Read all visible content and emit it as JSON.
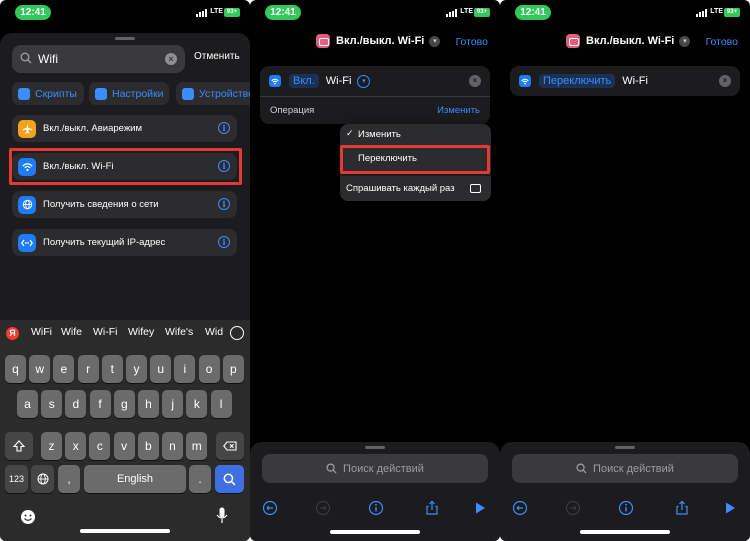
{
  "colors": {
    "accent": "#3b8cff",
    "status_green": "#34c759",
    "highlight_red": "#e53935"
  },
  "status_bar": {
    "time": "12:41",
    "network": "LTE",
    "battery": "93+"
  },
  "panel1": {
    "search": {
      "value": "Wifi",
      "placeholder": ""
    },
    "cancel_label": "Отменить",
    "chips": [
      {
        "label": "Скрипты",
        "icon": "script-icon"
      },
      {
        "label": "Настройки",
        "icon": "settings-icon"
      },
      {
        "label": "Устройство",
        "icon": "device-icon"
      }
    ],
    "results": [
      {
        "label": "Вкл./выкл. Авиарежим",
        "icon": "airplane-icon",
        "color": "#f4a21a"
      },
      {
        "label": "Вкл./выкл. Wi-Fi",
        "icon": "wifi-icon",
        "color": "#1f7bf6"
      },
      {
        "label": "Получить сведения о сети",
        "icon": "globe-icon",
        "color": "#1f7bf6"
      },
      {
        "label": "Получить текущий IP-адрес",
        "icon": "code-icon",
        "color": "#1f7bf6"
      }
    ],
    "suggestions": [
      "WiFi",
      "Wife",
      "Wi-Fi",
      "Wifey",
      "Wife's",
      "Wid"
    ],
    "keyboard": {
      "row1": [
        "q",
        "w",
        "e",
        "r",
        "t",
        "y",
        "u",
        "i",
        "o",
        "p"
      ],
      "row2": [
        "a",
        "s",
        "d",
        "f",
        "g",
        "h",
        "j",
        "k",
        "l"
      ],
      "row3": [
        "z",
        "x",
        "c",
        "v",
        "b",
        "n",
        "m"
      ],
      "numbers_label": "123",
      "space_label": "English"
    }
  },
  "panel2": {
    "title": "Вкл./выкл. Wi-Fi",
    "done_label": "Готово",
    "action": {
      "token": "Вкл.",
      "param": "Wi-Fi"
    },
    "operation": {
      "label": "Операция",
      "value": "Изменить"
    },
    "menu": [
      {
        "label": "Изменить",
        "checked": true
      },
      {
        "label": "Переключить",
        "checked": false
      },
      {
        "label": "Спрашивать каждый раз",
        "checked": false
      }
    ],
    "search_actions": "Поиск действий"
  },
  "panel3": {
    "title": "Вкл./выкл. Wi-Fi",
    "done_label": "Готово",
    "action": {
      "token": "Переключить",
      "param": "Wi-Fi"
    },
    "search_actions": "Поиск действий"
  }
}
